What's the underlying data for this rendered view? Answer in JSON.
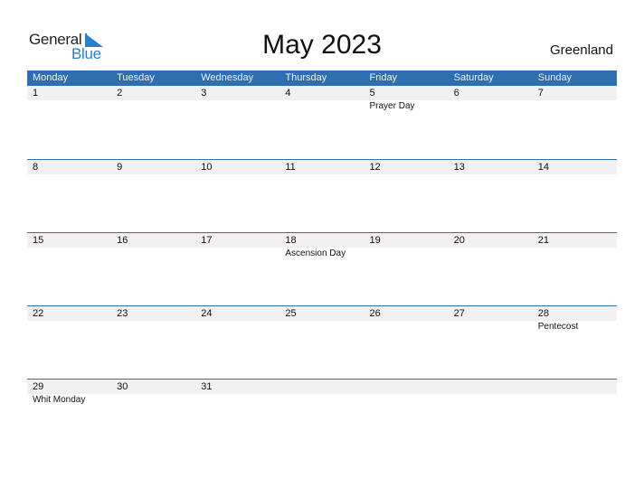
{
  "logo": {
    "line1": "General",
    "line2": "Blue"
  },
  "header": {
    "title": "May 2023",
    "country": "Greenland"
  },
  "weekdays": [
    "Monday",
    "Tuesday",
    "Wednesday",
    "Thursday",
    "Friday",
    "Saturday",
    "Sunday"
  ],
  "weeks": [
    [
      {
        "day": "1",
        "holiday": ""
      },
      {
        "day": "2",
        "holiday": ""
      },
      {
        "day": "3",
        "holiday": ""
      },
      {
        "day": "4",
        "holiday": ""
      },
      {
        "day": "5",
        "holiday": "Prayer Day"
      },
      {
        "day": "6",
        "holiday": ""
      },
      {
        "day": "7",
        "holiday": ""
      }
    ],
    [
      {
        "day": "8",
        "holiday": ""
      },
      {
        "day": "9",
        "holiday": ""
      },
      {
        "day": "10",
        "holiday": ""
      },
      {
        "day": "11",
        "holiday": ""
      },
      {
        "day": "12",
        "holiday": ""
      },
      {
        "day": "13",
        "holiday": ""
      },
      {
        "day": "14",
        "holiday": ""
      }
    ],
    [
      {
        "day": "15",
        "holiday": ""
      },
      {
        "day": "16",
        "holiday": ""
      },
      {
        "day": "17",
        "holiday": ""
      },
      {
        "day": "18",
        "holiday": "Ascension Day"
      },
      {
        "day": "19",
        "holiday": ""
      },
      {
        "day": "20",
        "holiday": ""
      },
      {
        "day": "21",
        "holiday": ""
      }
    ],
    [
      {
        "day": "22",
        "holiday": ""
      },
      {
        "day": "23",
        "holiday": ""
      },
      {
        "day": "24",
        "holiday": ""
      },
      {
        "day": "25",
        "holiday": ""
      },
      {
        "day": "26",
        "holiday": ""
      },
      {
        "day": "27",
        "holiday": ""
      },
      {
        "day": "28",
        "holiday": "Pentecost"
      }
    ],
    [
      {
        "day": "29",
        "holiday": "Whit Monday"
      },
      {
        "day": "30",
        "holiday": ""
      },
      {
        "day": "31",
        "holiday": ""
      },
      {
        "day": "",
        "holiday": ""
      },
      {
        "day": "",
        "holiday": ""
      },
      {
        "day": "",
        "holiday": ""
      },
      {
        "day": "",
        "holiday": ""
      }
    ]
  ],
  "colors": {
    "accent": "#2e6fb0",
    "logo_blue": "#2a7fc7",
    "day_strip": "#f1f1f1"
  }
}
